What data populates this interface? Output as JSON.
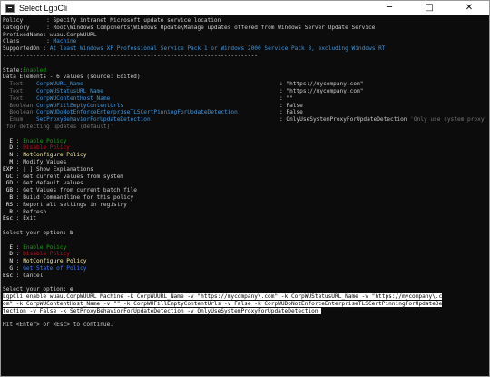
{
  "window": {
    "title": "Select LgpCli",
    "controls": {
      "minimize": "─",
      "maximize": "□",
      "close": "✕"
    }
  },
  "policy": {
    "lines": [
      {
        "key": "Policy       ",
        "sep": ": ",
        "value": "Specify intranet Microsoft update service location",
        "color": "w"
      },
      {
        "key": "Category     ",
        "sep": ": ",
        "value": "Root\\Windows Components\\Windows Update\\Manage updates offered from Windows Server Update Service",
        "color": "w"
      },
      {
        "key": "PrefixedName",
        "sep": ": ",
        "value": "wuau.CorpWUURL",
        "color": "w"
      },
      {
        "key": "Class        ",
        "sep": ": ",
        "value": "Machine",
        "color": "c"
      },
      {
        "key": "SupportedOn ",
        "sep": ": ",
        "value": "At least Windows XP Professional Service Pack 1 or Windows 2000 Service Pack 3, excluding Windows RT",
        "color": "c"
      }
    ],
    "divider": "----------------------------------------------------------------------------",
    "state_label": "State:",
    "state_value": "Enabled",
    "elements_header": "Data Elements - 6 values (source: Edited):"
  },
  "elements": [
    {
      "type": "  Text   ",
      "name": "CorpWUURL_Name",
      "value": "\"https://mycompany.com\""
    },
    {
      "type": "  Text   ",
      "name": "CorpWUStatusURL_Name",
      "value": "\"https://mycompany.com\""
    },
    {
      "type": "  Text   ",
      "name": "CorpWUContentHost_Name",
      "value": "\"\""
    },
    {
      "type": "  Boolean",
      "name": "CorpWUFillEmptyContentUrls",
      "value": "False"
    },
    {
      "type": "  Boolean",
      "name": "CorpWUDoNotEnforceEnterpriseTLSCertPinningForUpdateDetection",
      "value": "False"
    },
    {
      "type": "  Enum   ",
      "name": "SetProxyBehaviorForUpdateDetection",
      "value": "OnlyUseSystemProxyForUpdateDetection",
      "extra": " 'Only use system proxy"
    }
  ],
  "element_wrap": " for detecting updates (default)'",
  "menu1": [
    {
      "key": "  E ",
      "label": "Enable Policy",
      "color": "g"
    },
    {
      "key": "  D ",
      "label": "Disable Policy",
      "color": "r"
    },
    {
      "key": "  N ",
      "label": "NotConfigure Policy",
      "color": "y"
    },
    {
      "key": "  M ",
      "label": "Modify Values",
      "color": "w"
    },
    {
      "key": "EXP ",
      "label": "[ ] Show Explanations",
      "color": "w"
    },
    {
      "key": " GC ",
      "label": "Get current values from system",
      "color": "w"
    },
    {
      "key": " GD ",
      "label": "Get default values",
      "color": "w"
    },
    {
      "key": " GB ",
      "label": "Get Values from current batch file",
      "color": "w"
    },
    {
      "key": "  B ",
      "label": "Build Commandline for this policy",
      "color": "w"
    },
    {
      "key": " RS ",
      "label": "Report all settings in registry",
      "color": "w"
    },
    {
      "key": "  R ",
      "label": "Refresh",
      "color": "w"
    },
    {
      "key": "Esc ",
      "label": "Exit",
      "color": "w"
    }
  ],
  "prompt1": "Select your option: ",
  "answer1": "b",
  "menu2": [
    {
      "key": "  E ",
      "label": "Enable Policy",
      "color": "g"
    },
    {
      "key": "  D ",
      "label": "Disable Policy",
      "color": "r"
    },
    {
      "key": "  N ",
      "label": "NotConfigure Policy",
      "color": "y"
    },
    {
      "key": "  G ",
      "label": "Get State of Policy",
      "color": "b"
    },
    {
      "key": "Esc ",
      "label": "Cancel",
      "color": "w"
    }
  ],
  "prompt2": "Select your option: ",
  "answer2": "e",
  "command_lines": [
    "LgpCli enable wuau.CorpWUURL Machine -k CorpWUURL_Name -v \"https://mycompany\\.com\" -k CorpWUStatusURL_Name -v \"https://mycompany\\.c",
    "om\" -k CorpWUContentHost_Name -v \"\" -k CorpWUFillEmptyContentUrls -v False -k CorpWUDoNotEnforceEnterpriseTLSCertPinningForUpdateDe",
    "tection -v False -k SetProxyBehaviorForUpdateDetection -v OnlyUseSystemProxyForUpdateDetection "
  ],
  "footer": "Hit <Enter> or <Esc> to continue."
}
